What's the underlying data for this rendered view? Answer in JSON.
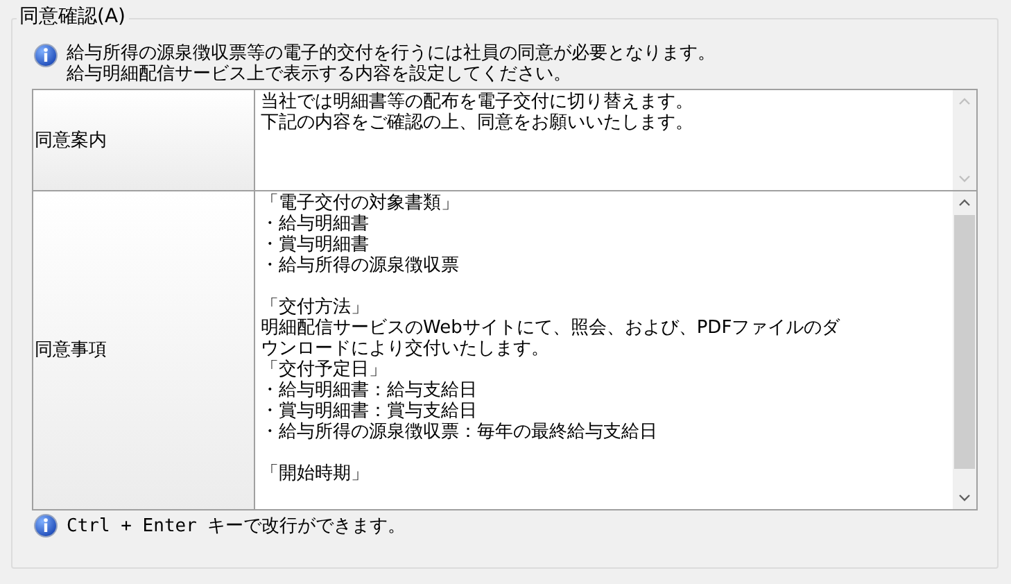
{
  "group": {
    "title": "同意確認(A)"
  },
  "info": {
    "lines": [
      "給与所得の源泉徴収票等の電子的交付を行うには社員の同意が必要となります。",
      "給与明細配信サービス上で表示する内容を設定してください。"
    ]
  },
  "rows": [
    {
      "label": "同意案内",
      "paragraphs": [
        [
          "当社では明細書等の配布を電子交付に切り替えます。",
          "下記の内容をご確認の上、同意をお願いいたします。"
        ]
      ],
      "scrollable": false
    },
    {
      "label": "同意事項",
      "paragraphs": [
        [
          "「電子交付の対象書類」",
          "・給与明細書",
          "・賞与明細書",
          "・給与所得の源泉徴収票"
        ],
        [
          "「交付方法」",
          "明細配信サービスのWebサイトにて、照会、および、PDFファイルのダ",
          "ウンロードにより交付いたします。",
          "「交付予定日」",
          "・給与明細書：給与支給日",
          "・賞与明細書：賞与支給日",
          "・給与所得の源泉徴収票：毎年の最終給与支給日"
        ],
        [
          "「開始時期」"
        ]
      ],
      "scrollable": true
    }
  ],
  "hint": {
    "text": "Ctrl + Enter キーで改行ができます。"
  }
}
